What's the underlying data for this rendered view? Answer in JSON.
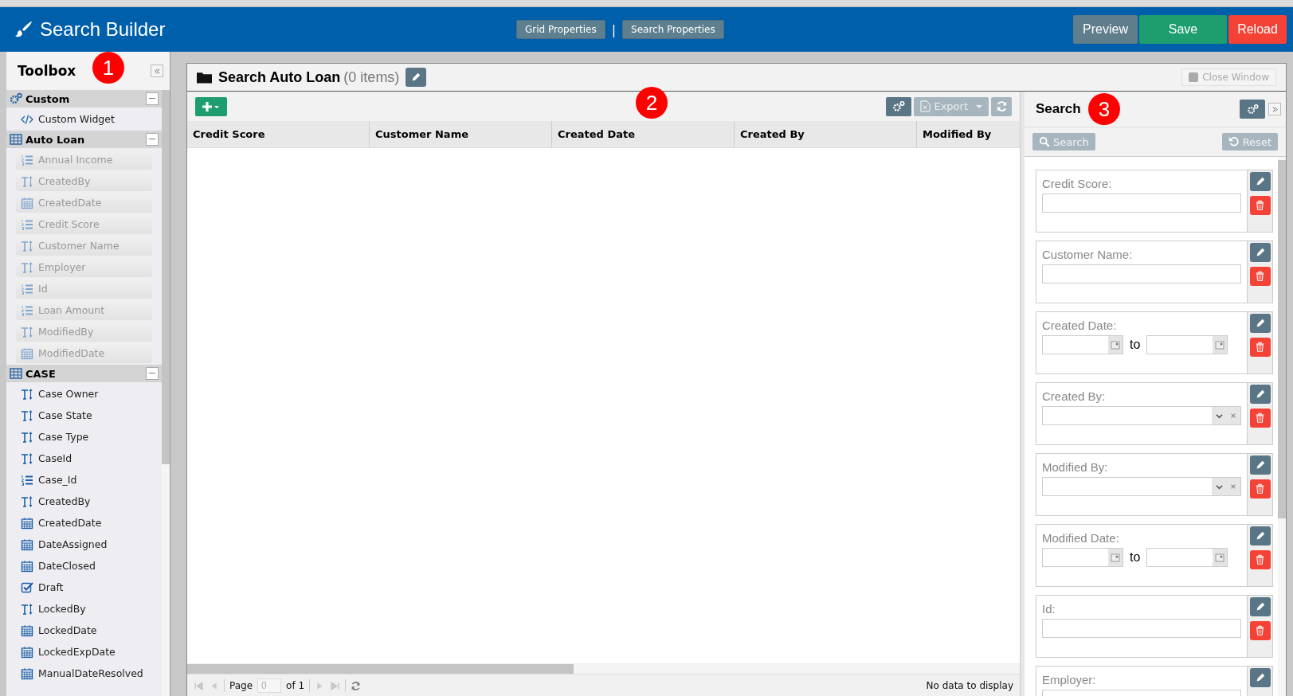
{
  "header": {
    "title": "Search Builder",
    "tabs": [
      {
        "label": "Grid Properties"
      },
      {
        "label": "Search Properties"
      }
    ],
    "separator": "|",
    "buttons": [
      {
        "label": "Preview",
        "kind": "neutral"
      },
      {
        "label": "Save",
        "kind": "success"
      },
      {
        "label": "Reload",
        "kind": "danger"
      }
    ]
  },
  "annotations": [
    "1",
    "2",
    "3"
  ],
  "toolbox": {
    "title": "Toolbox",
    "sections": [
      {
        "title": "Custom",
        "kind": "custom",
        "items": [
          {
            "label": "Custom Widget",
            "kind": "code",
            "disabled": false
          }
        ]
      },
      {
        "title": "Auto Loan",
        "kind": "entity",
        "items": [
          {
            "label": "Annual Income",
            "kind": "number",
            "disabled": true
          },
          {
            "label": "CreatedBy",
            "kind": "text",
            "disabled": true
          },
          {
            "label": "CreatedDate",
            "kind": "date",
            "disabled": true
          },
          {
            "label": "Credit Score",
            "kind": "number",
            "disabled": true
          },
          {
            "label": "Customer Name",
            "kind": "text",
            "disabled": true
          },
          {
            "label": "Employer",
            "kind": "text",
            "disabled": true
          },
          {
            "label": "Id",
            "kind": "number",
            "disabled": true
          },
          {
            "label": "Loan Amount",
            "kind": "number",
            "disabled": true
          },
          {
            "label": "ModifiedBy",
            "kind": "text",
            "disabled": true
          },
          {
            "label": "ModifiedDate",
            "kind": "date",
            "disabled": true
          }
        ]
      },
      {
        "title": "CASE",
        "kind": "entity",
        "items": [
          {
            "label": "Case Owner",
            "kind": "text",
            "disabled": false
          },
          {
            "label": "Case State",
            "kind": "text",
            "disabled": false
          },
          {
            "label": "Case Type",
            "kind": "text",
            "disabled": false
          },
          {
            "label": "CaseId",
            "kind": "text",
            "disabled": false
          },
          {
            "label": "Case_Id",
            "kind": "number",
            "disabled": false
          },
          {
            "label": "CreatedBy",
            "kind": "text",
            "disabled": false
          },
          {
            "label": "CreatedDate",
            "kind": "date",
            "disabled": false
          },
          {
            "label": "DateAssigned",
            "kind": "date",
            "disabled": false
          },
          {
            "label": "DateClosed",
            "kind": "date",
            "disabled": false
          },
          {
            "label": "Draft",
            "kind": "boolean",
            "disabled": false
          },
          {
            "label": "LockedBy",
            "kind": "text",
            "disabled": false
          },
          {
            "label": "LockedDate",
            "kind": "date",
            "disabled": false
          },
          {
            "label": "LockedExpDate",
            "kind": "date",
            "disabled": false
          },
          {
            "label": "ManualDateResolved",
            "kind": "date",
            "disabled": false
          }
        ]
      }
    ]
  },
  "window": {
    "title": "Search Auto Loan",
    "count": "(0 items)",
    "close_button": "Close Window"
  },
  "grid": {
    "export_button": "Export",
    "columns": [
      "Credit Score",
      "Customer Name",
      "Created Date",
      "Created By",
      "Modified By"
    ],
    "pager": {
      "page_label": "Page",
      "page_value": "0",
      "of_label": "of 1",
      "status": "No data to display"
    }
  },
  "search": {
    "title": "Search",
    "search_button": "Search",
    "reset_button": "Reset",
    "fields": [
      {
        "label": "Credit Score:",
        "kind": "text"
      },
      {
        "label": "Customer Name:",
        "kind": "text"
      },
      {
        "label": "Created Date:",
        "kind": "daterange",
        "to": "to"
      },
      {
        "label": "Created By:",
        "kind": "combo"
      },
      {
        "label": "Modified By:",
        "kind": "combo"
      },
      {
        "label": "Modified Date:",
        "kind": "daterange",
        "to": "to"
      },
      {
        "label": "Id:",
        "kind": "text"
      },
      {
        "label": "Employer:",
        "kind": "text"
      }
    ]
  }
}
